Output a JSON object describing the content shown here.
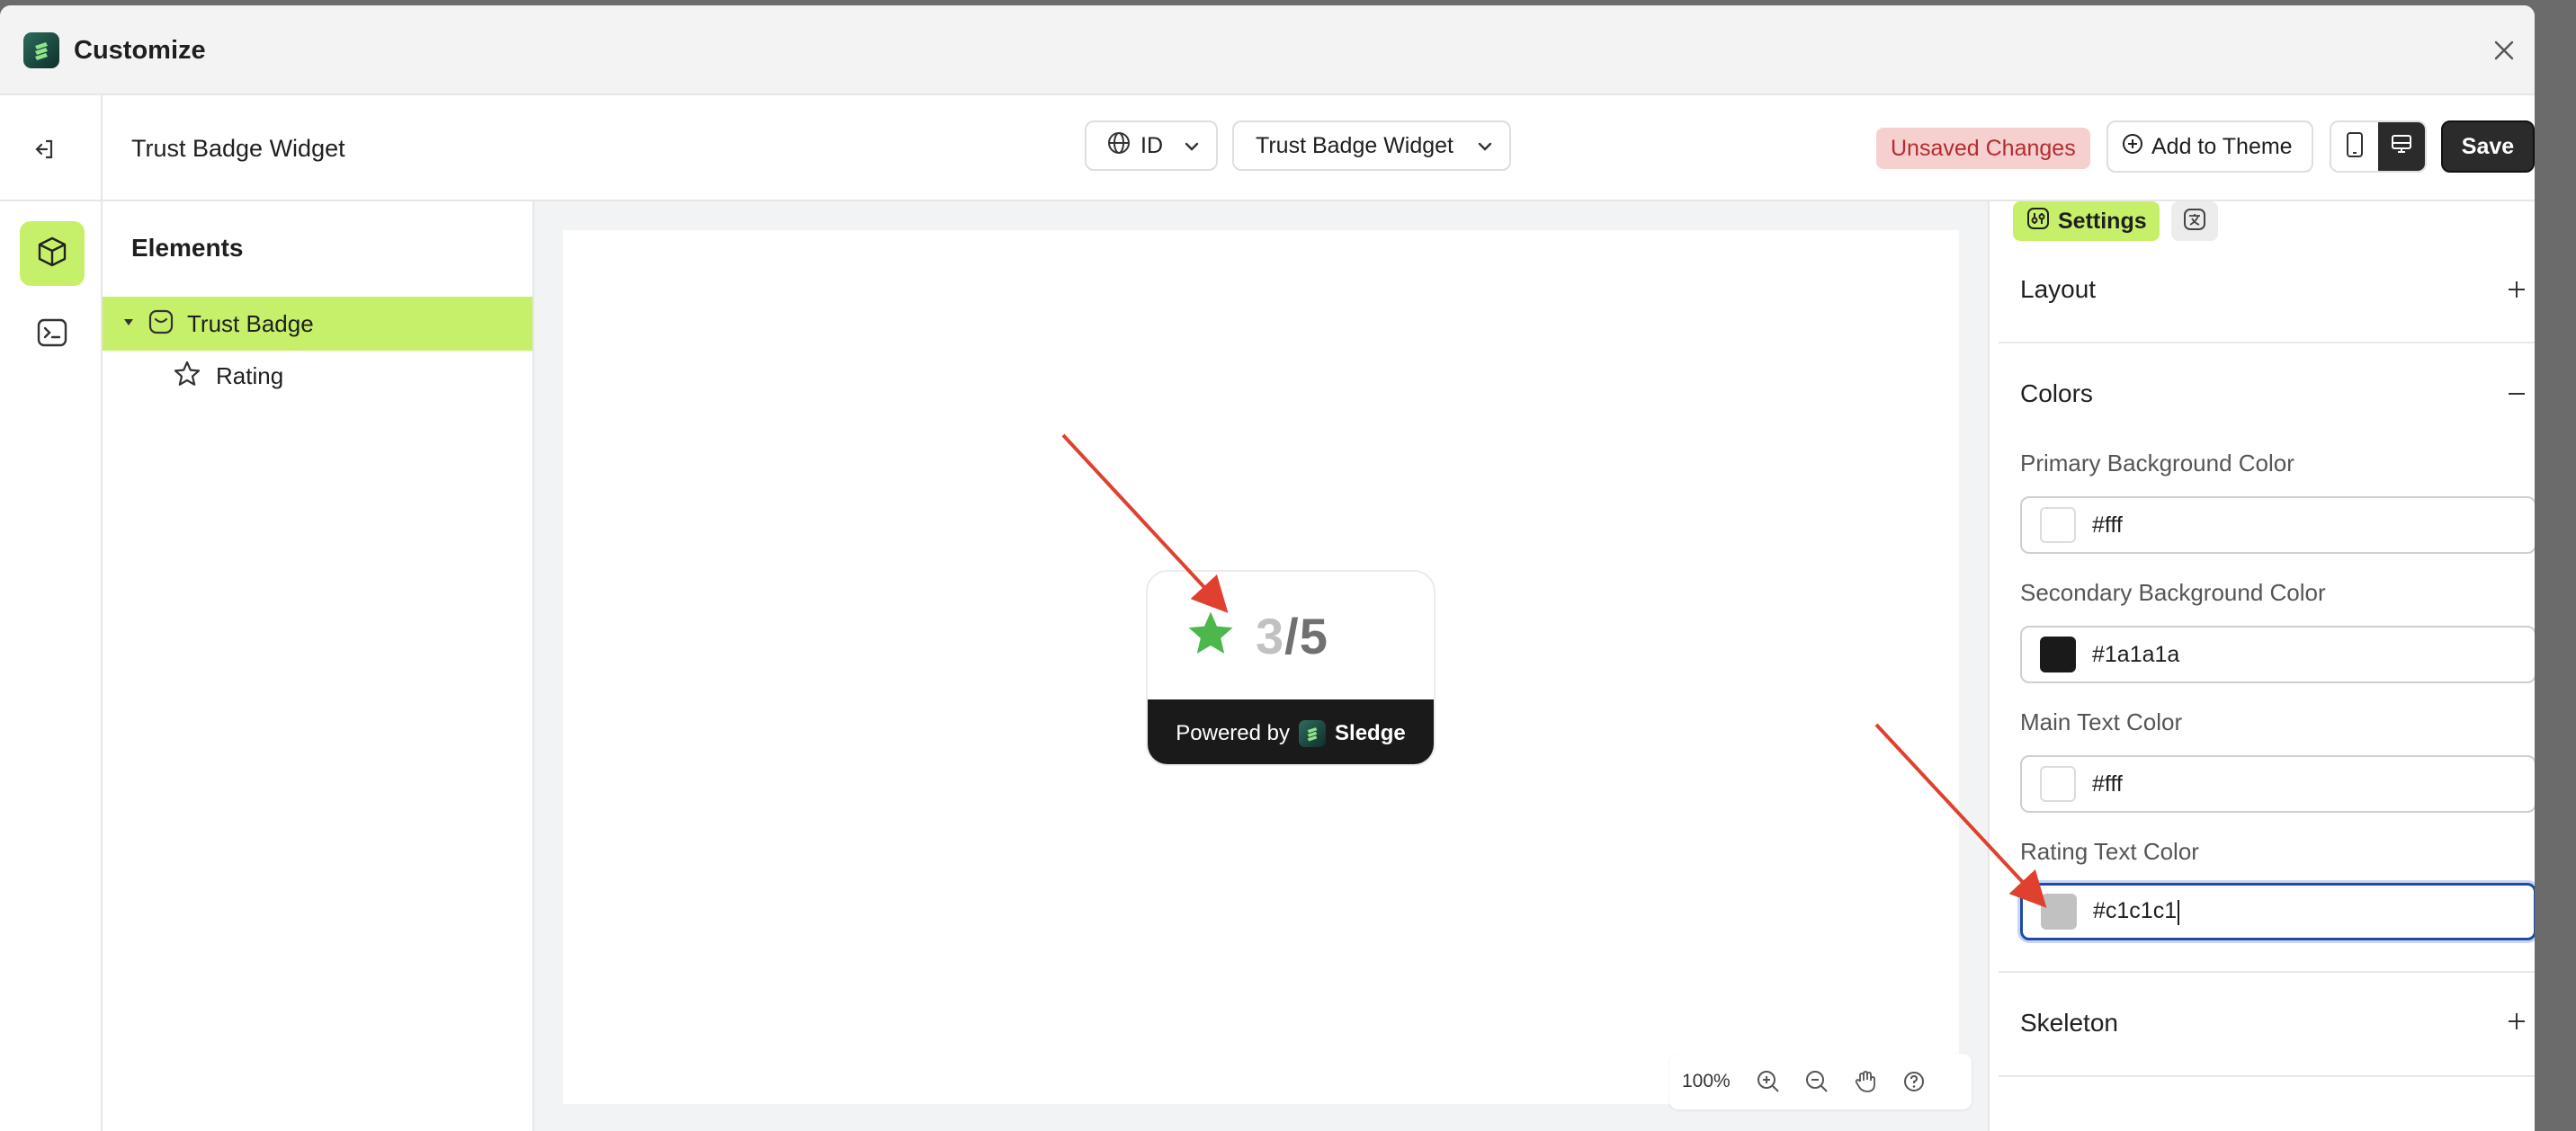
{
  "window": {
    "title": "Customize"
  },
  "toolbar": {
    "page_name": "Trust Badge Widget",
    "language": "ID",
    "widget_selector": "Trust Badge Widget",
    "unsaved_label": "Unsaved Changes",
    "add_to_theme_label": "Add to Theme",
    "save_label": "Save"
  },
  "elements_panel": {
    "title": "Elements",
    "items": [
      {
        "label": "Trust Badge",
        "icon": "badge-icon",
        "selected": true
      },
      {
        "label": "Rating",
        "icon": "star-icon",
        "selected": false
      }
    ]
  },
  "preview": {
    "rating_current": "3",
    "rating_rest": "/5",
    "powered_by": "Powered by",
    "brand": "Sledge",
    "star_color": "#4cb84c",
    "zoom_level": "100%"
  },
  "settings": {
    "tab_label": "Settings",
    "sections": {
      "layout": "Layout",
      "colors": "Colors",
      "skeleton": "Skeleton"
    },
    "fields": [
      {
        "label": "Primary Background Color",
        "value": "#fff",
        "swatch": "#ffffff"
      },
      {
        "label": "Secondary Background Color",
        "value": "#1a1a1a",
        "swatch": "#1a1a1a"
      },
      {
        "label": "Main Text Color",
        "value": "#fff",
        "swatch": "#ffffff"
      },
      {
        "label": "Rating Text Color",
        "value": "#c1c1c1",
        "swatch": "#c1c1c1",
        "focused": true
      }
    ]
  },
  "colors": {
    "accent": "#c7f06a",
    "unsaved_bg": "#f6cfcf",
    "unsaved_text": "#b32d2d",
    "annotation_arrow": "#e0412f"
  }
}
